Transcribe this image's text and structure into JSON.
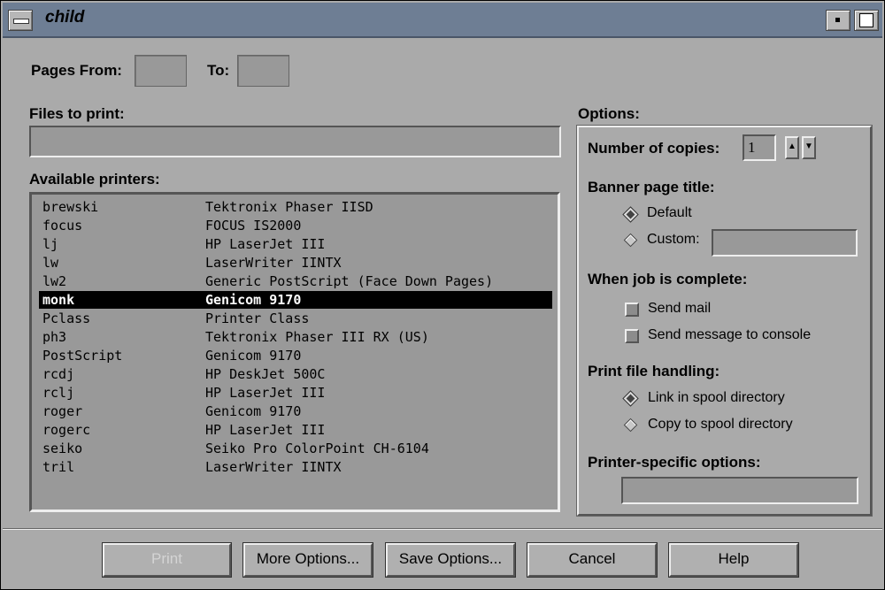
{
  "window": {
    "title": "child"
  },
  "pages": {
    "from_label": "Pages From:",
    "from_value": "",
    "to_label": "To:",
    "to_value": ""
  },
  "files": {
    "label": "Files to print:",
    "value": ""
  },
  "printers": {
    "label": "Available printers:",
    "selected_index": 5,
    "rows": [
      {
        "name": "brewski",
        "desc": "Tektronix Phaser IISD"
      },
      {
        "name": "focus",
        "desc": "FOCUS IS2000"
      },
      {
        "name": "lj",
        "desc": "HP LaserJet III"
      },
      {
        "name": "lw",
        "desc": "LaserWriter IINTX"
      },
      {
        "name": "lw2",
        "desc": "Generic PostScript (Face Down Pages)"
      },
      {
        "name": "monk",
        "desc": "Genicom 9170"
      },
      {
        "name": "Pclass",
        "desc": "Printer Class"
      },
      {
        "name": "ph3",
        "desc": "Tektronix Phaser III RX (US)"
      },
      {
        "name": "PostScript",
        "desc": "Genicom 9170"
      },
      {
        "name": "rcdj",
        "desc": "HP DeskJet 500C"
      },
      {
        "name": "rclj",
        "desc": "HP LaserJet III"
      },
      {
        "name": "roger",
        "desc": "Genicom 9170"
      },
      {
        "name": "rogerc",
        "desc": "HP LaserJet III"
      },
      {
        "name": "seiko",
        "desc": "Seiko Pro ColorPoint CH-6104"
      },
      {
        "name": "tril",
        "desc": "LaserWriter IINTX"
      }
    ]
  },
  "options": {
    "label": "Options:",
    "copies_label": "Number of copies:",
    "copies_value": "1",
    "banner_label": "Banner page title:",
    "banner_default": "Default",
    "banner_custom": "Custom:",
    "banner_custom_value": "",
    "banner_selected": "Default",
    "complete_label": "When job is complete:",
    "send_mail": "Send mail",
    "send_console": "Send message to console",
    "handling_label": "Print file handling:",
    "handling_link": "Link in spool directory",
    "handling_copy": "Copy to spool directory",
    "handling_selected": "Link in spool directory",
    "specific_label": "Printer-specific options:",
    "specific_value": ""
  },
  "buttons": {
    "print": "Print",
    "print_enabled": false,
    "more": "More Options...",
    "save": "Save Options...",
    "cancel": "Cancel",
    "help": "Help"
  },
  "icons": [
    "window-menu-icon",
    "minimize-icon",
    "maximize-icon",
    "spin-up-icon",
    "spin-down-icon"
  ],
  "colors": {
    "titlebar": "#6e7e94",
    "panel": "#aaaaaa",
    "field": "#999999",
    "selection": "#000000"
  }
}
